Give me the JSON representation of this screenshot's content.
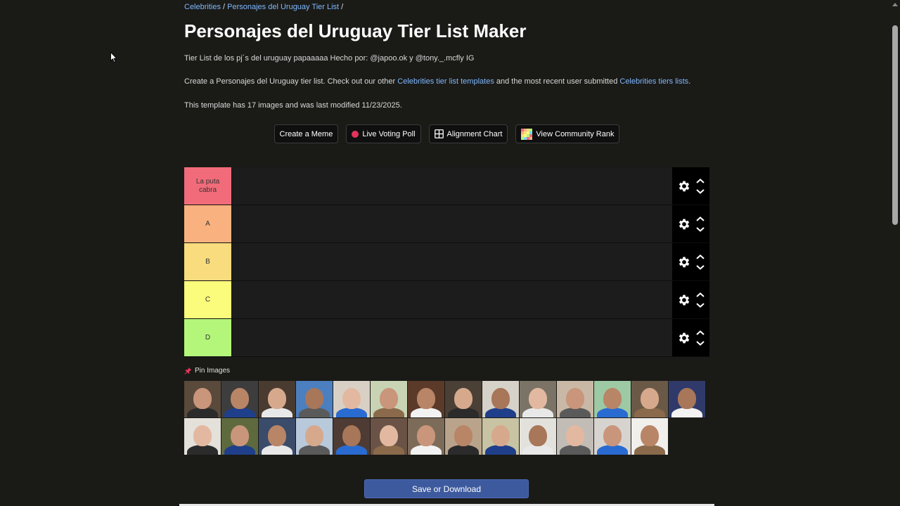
{
  "breadcrumb": {
    "link1": "Celebrities",
    "sep1": " / ",
    "link2": "Personajes del Uruguay Tier List",
    "sep2": " /"
  },
  "page": {
    "title": "Personajes del Uruguay Tier List Maker",
    "description": "Tier List de los pj´s del uruguay papaaaaa Hecho por: @japoo.ok y @tony._.mcfly IG",
    "create_pre": "Create a Personajes del Uruguay tier list. Check out our other ",
    "create_link1": "Celebrities tier list templates",
    "create_mid": " and the most recent user submitted ",
    "create_link2": "Celebrities tiers lists",
    "create_post": ".",
    "template_info": "This template has 17 images and was last modified 11/23/2025."
  },
  "buttons": {
    "meme": "Create a Meme",
    "poll": "Live Voting Poll",
    "alignment": "Alignment Chart",
    "community": "View Community Rank"
  },
  "tiers": [
    {
      "label": "La puta cabra",
      "color": "#f26b7a"
    },
    {
      "label": "A",
      "color": "#f9b27f"
    },
    {
      "label": "B",
      "color": "#f8dc7e"
    },
    {
      "label": "C",
      "color": "#fbfb7c"
    },
    {
      "label": "D",
      "color": "#b3f67a"
    }
  ],
  "pin_label": "Pin Images",
  "pool_count": 27,
  "save_label": "Save or Download",
  "colors": {
    "accent_link": "#7fb8ff",
    "save_button": "#3d5a9e",
    "background": "#1a1a17"
  }
}
